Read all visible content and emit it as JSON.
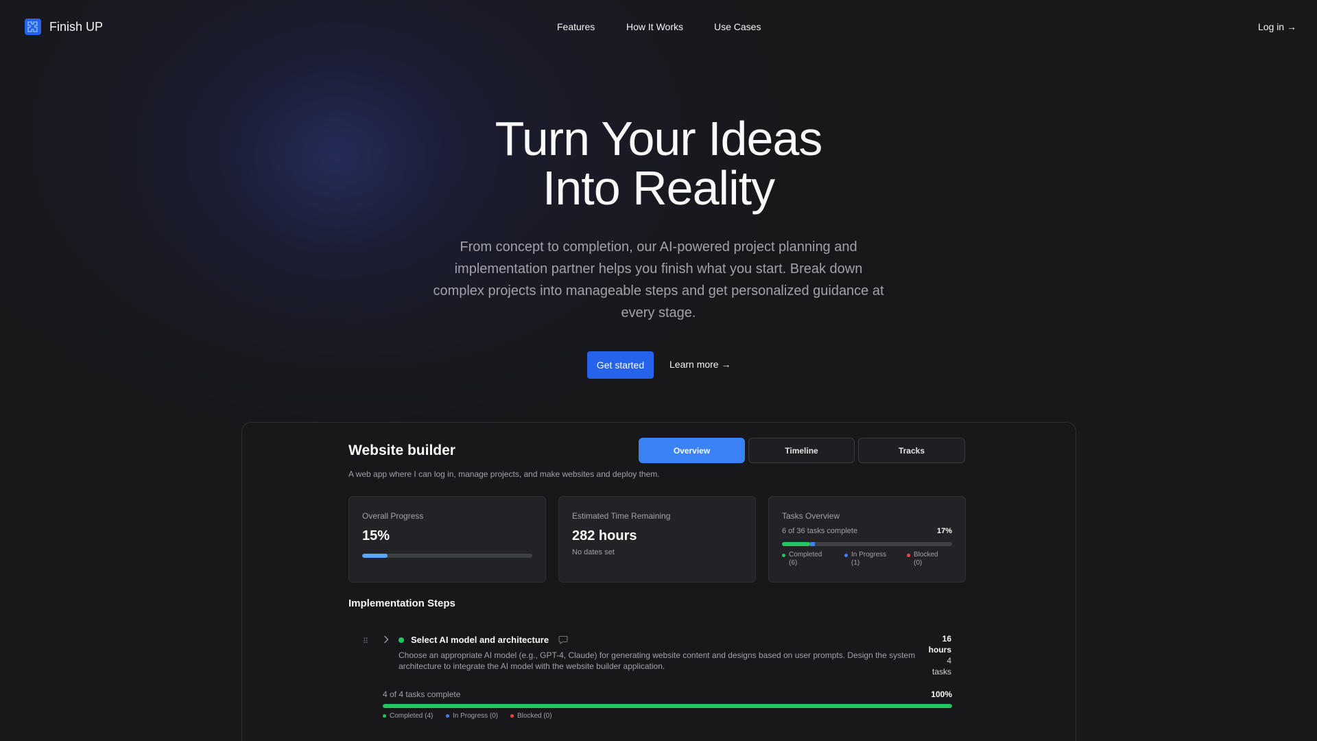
{
  "brand": {
    "name": "Finish UP",
    "logo_icon": "puzzle-icon",
    "accent": "#2563eb"
  },
  "nav": {
    "links": [
      "Features",
      "How It Works",
      "Use Cases"
    ],
    "login": "Log in →"
  },
  "hero": {
    "title_line1": "Turn Your Ideas",
    "title_line2": "Into Reality",
    "subtitle": "From concept to completion, our AI-powered project planning and implementation partner helps you finish what you start. Break down complex projects into manageable steps and get personalized guidance at every stage.",
    "primary_cta": "Get started",
    "secondary_cta": "Learn more →"
  },
  "preview": {
    "project_title": "Website builder",
    "project_desc": "A web app where I can log in, manage projects, and make websites and deploy them.",
    "tabs": [
      {
        "label": "Overview",
        "active": true
      },
      {
        "label": "Timeline",
        "active": false
      },
      {
        "label": "Tracks",
        "active": false
      }
    ],
    "cards": {
      "progress": {
        "label": "Overall Progress",
        "value": "15%",
        "fraction": 0.15,
        "color": "#60a5fa"
      },
      "time": {
        "label": "Estimated Time Remaining",
        "value": "282 hours",
        "sub": "No dates set"
      },
      "tasks": {
        "label": "Tasks Overview",
        "line": "6 of 36 tasks complete",
        "pct": "17%",
        "completed_fraction": 0.167,
        "in_progress_fraction": 0.028,
        "legend_completed_1": "Completed",
        "legend_completed_2": "(6)",
        "legend_progress_1": "In Progress",
        "legend_progress_2": "(1)",
        "legend_blocked_1": "Blocked",
        "legend_blocked_2": "(0)"
      }
    },
    "colors": {
      "completed": "#22c55e",
      "in_progress": "#3b82f6",
      "blocked": "#ef4444"
    },
    "section_title": "Implementation Steps",
    "step": {
      "title": "Select AI model and architecture",
      "description": "Choose an appropriate AI model (e.g., GPT-4, Claude) for generating website content and designs based on user prompts. Design the system architecture to integrate the AI model with the website builder application.",
      "hours_1": "16",
      "hours_2": "hours",
      "tasks_1": "4",
      "tasks_2": "tasks",
      "count": "4 of 4 tasks complete",
      "pct": "100%",
      "fraction": 1.0,
      "legend_completed": "Completed (4)",
      "legend_progress": "In Progress (0)",
      "legend_blocked": "Blocked (0)"
    }
  }
}
